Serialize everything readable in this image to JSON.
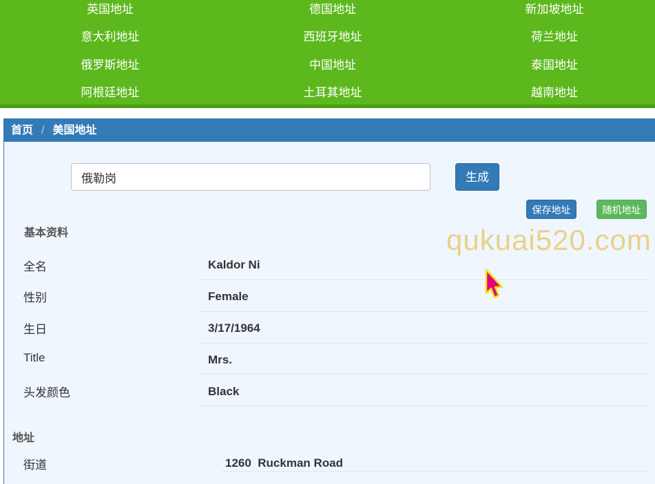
{
  "countries": [
    {
      "label": "英国地址"
    },
    {
      "label": "德国地址"
    },
    {
      "label": "新加坡地址"
    },
    {
      "label": "意大利地址"
    },
    {
      "label": "西班牙地址"
    },
    {
      "label": "荷兰地址"
    },
    {
      "label": "俄罗斯地址"
    },
    {
      "label": "中国地址"
    },
    {
      "label": "泰国地址"
    },
    {
      "label": "阿根廷地址"
    },
    {
      "label": "土耳其地址"
    },
    {
      "label": "越南地址"
    }
  ],
  "breadcrumb": {
    "home": "首页",
    "separator": "/",
    "current": "美国地址"
  },
  "search": {
    "value": "俄勒岗"
  },
  "buttons": {
    "generate": "生成",
    "save": "保存地址",
    "random": "随机地址"
  },
  "watermark": "qukuai520.com",
  "profile": {
    "title": "基本资料",
    "rows": [
      {
        "label": "全名",
        "value": "Kaldor Ni"
      },
      {
        "label": "性别",
        "value": "Female"
      },
      {
        "label": "生日",
        "value": "3/17/1964"
      },
      {
        "label": "Title",
        "value": "Mrs."
      },
      {
        "label": "头发颜色",
        "value": "Black"
      }
    ]
  },
  "address": {
    "title": "地址",
    "rows": [
      {
        "label": "街道",
        "value": "1260  Ruckman Road"
      }
    ]
  },
  "colors": {
    "nav_green": "#5cb81c",
    "primary_blue": "#337ab7",
    "success_green": "#5cb85c",
    "cursor": "#e6007e"
  }
}
